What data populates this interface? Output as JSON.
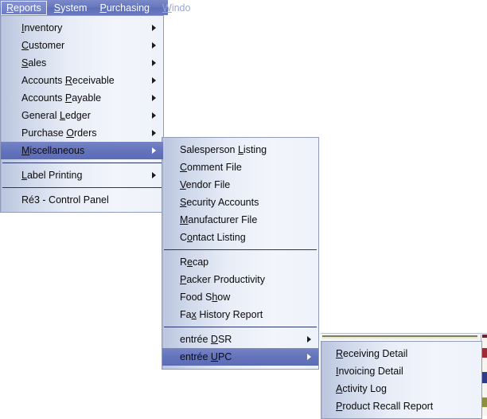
{
  "menubar": {
    "items": [
      {
        "label": "Reports",
        "accel": "R",
        "state": "selected"
      },
      {
        "label": "System",
        "accel": "S",
        "state": "normal"
      },
      {
        "label": "Purchasing",
        "accel": "P",
        "state": "normal"
      },
      {
        "label": "Windo",
        "accel": "W",
        "state": "disabled"
      }
    ]
  },
  "menu_reports": {
    "name": "Reports",
    "items": [
      {
        "label": "Inventory",
        "accel": "I",
        "submenu": true,
        "highlighted": false
      },
      {
        "label": "Customer",
        "accel": "C",
        "submenu": true,
        "highlighted": false
      },
      {
        "label": "Sales",
        "accel": "S",
        "submenu": true,
        "highlighted": false
      },
      {
        "label": "Accounts Receivable",
        "accel": "R",
        "submenu": true,
        "highlighted": false
      },
      {
        "label": "Accounts Payable",
        "accel": "P",
        "submenu": true,
        "highlighted": false
      },
      {
        "label": "General Ledger",
        "accel": "L",
        "submenu": true,
        "highlighted": false
      },
      {
        "label": "Purchase Orders",
        "accel": "O",
        "submenu": true,
        "highlighted": false
      },
      {
        "label": "Miscellaneous",
        "accel": "M",
        "submenu": true,
        "highlighted": true
      },
      {
        "separator": true
      },
      {
        "label": "Label Printing",
        "accel": "L",
        "submenu": true,
        "highlighted": false
      },
      {
        "separator": true
      },
      {
        "label": "Ré3 - Control Panel",
        "accel": "",
        "submenu": false,
        "highlighted": false
      }
    ]
  },
  "menu_miscellaneous": {
    "name": "Miscellaneous",
    "items": [
      {
        "label": "Salesperson Listing",
        "accel": "L",
        "submenu": false,
        "highlighted": false
      },
      {
        "label": "Comment File",
        "accel": "C",
        "submenu": false,
        "highlighted": false
      },
      {
        "label": "Vendor File",
        "accel": "V",
        "submenu": false,
        "highlighted": false
      },
      {
        "label": "Security Accounts",
        "accel": "S",
        "submenu": false,
        "highlighted": false
      },
      {
        "label": "Manufacturer File",
        "accel": "M",
        "submenu": false,
        "highlighted": false
      },
      {
        "label": "Contact Listing",
        "accel": "o",
        "submenu": false,
        "highlighted": false
      },
      {
        "separator": true
      },
      {
        "label": "Recap",
        "accel": "e",
        "submenu": false,
        "highlighted": false
      },
      {
        "label": "Packer Productivity",
        "accel": "P",
        "submenu": false,
        "highlighted": false
      },
      {
        "label": "Food Show",
        "accel": "h",
        "submenu": false,
        "highlighted": false
      },
      {
        "label": "Fax History Report",
        "accel": "x",
        "submenu": false,
        "highlighted": false
      },
      {
        "separator": true
      },
      {
        "label": "entrée DSR",
        "accel": "D",
        "submenu": true,
        "highlighted": false
      },
      {
        "label": "entrée UPC",
        "accel": "U",
        "submenu": true,
        "highlighted": true
      }
    ]
  },
  "menu_entree_upc": {
    "name": "entrée UPC",
    "items": [
      {
        "label": "Receiving Detail",
        "accel": "R",
        "submenu": false,
        "highlighted": false
      },
      {
        "label": "Invoicing Detail",
        "accel": "I",
        "submenu": false,
        "highlighted": false
      },
      {
        "label": "Activity Log",
        "accel": "A",
        "submenu": false,
        "highlighted": false
      },
      {
        "label": "Product Recall Report",
        "accel": "P",
        "submenu": false,
        "highlighted": false
      }
    ]
  },
  "colors": {
    "menubar_blue": "#6676bd",
    "highlight_blue": "#6474bc",
    "menu_panel_light": "#eef2fa",
    "menu_panel_edge": "#b9c4dd",
    "separator": "#2a3570",
    "text": "#0a0a0a",
    "disabled_text": "#9aa6d8"
  }
}
